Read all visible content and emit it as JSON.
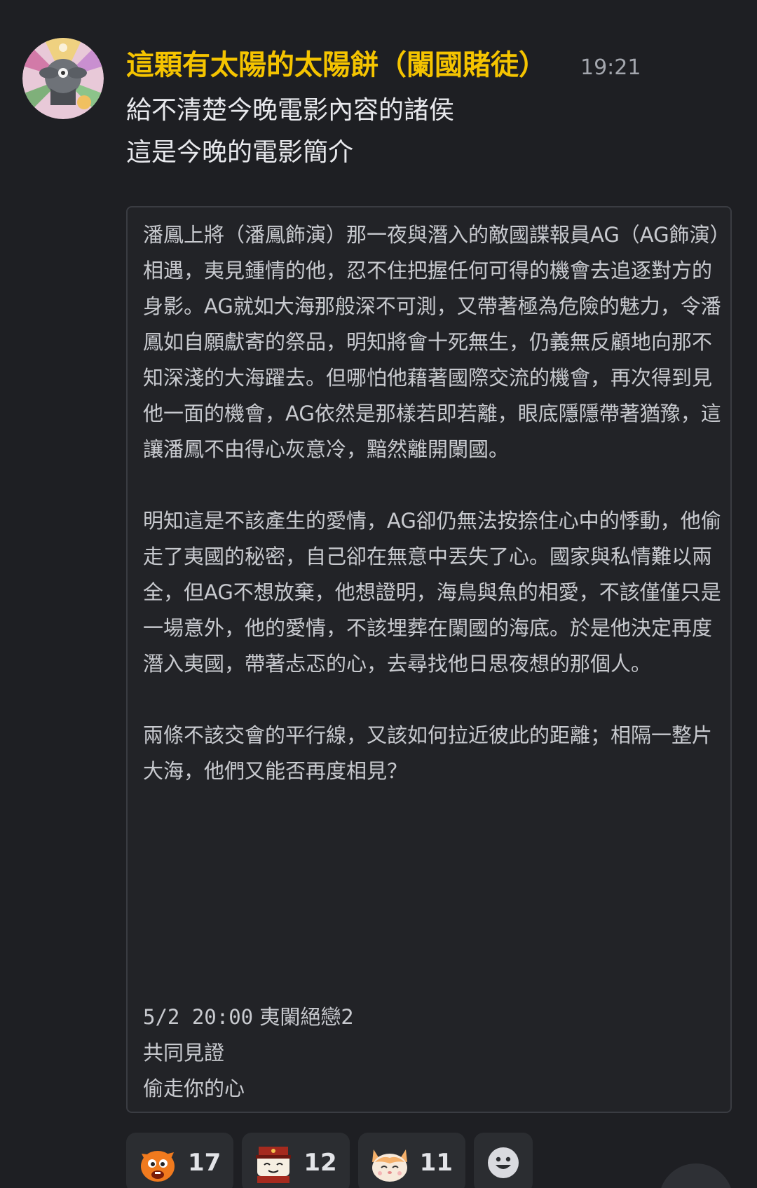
{
  "message": {
    "username": "這顆有太陽的太陽餅（闌國賭徒）",
    "timestamp": "19:21",
    "lines": [
      "給不清楚今晚電影內容的諸侯",
      "這是今晚的電影簡介"
    ],
    "codeblock": {
      "paragraphs": [
        "潘鳳上將（潘鳳飾演）那一夜與潛入的敵國諜報員AG（AG飾演）相遇，夷見鍾情的他，忍不住把握任何可得的機會去追逐對方的身影。AG就如大海那般深不可測，又帶著極為危險的魅力，令潘鳳如自願獻寄的祭品，明知將會十死無生，仍義無反顧地向那不知深淺的大海躍去。但哪怕他藉著國際交流的機會，再次得到見他一面的機會，AG依然是那樣若即若離，眼底隱隱帶著猶豫，這讓潘鳳不由得心灰意冷，黯然離開闌國。",
        "明知這是不該產生的愛情，AG卻仍無法按捺住心中的悸動，他偷走了夷國的秘密，自己卻在無意中丟失了心。國家與私情難以兩全，但AG不想放棄，他想證明，海鳥與魚的相愛，不該僅僅只是一場意外，他的愛情，不該埋葬在闌國的海底。於是他決定再度潛入夷國，帶著忐忑的心，去尋找他日思夜想的那個人。",
        "兩條不該交會的平行線，又該如何拉近彼此的距離；相隔一整片大海，他們又能否再度相見？"
      ],
      "footer": {
        "date_time": "5/2 20:00",
        "title": "夷闌絕戀2",
        "line2": "共同見證",
        "line3": "偷走你的心"
      }
    },
    "reactions": [
      {
        "emoji": "orange-cat-emoji",
        "count": "17"
      },
      {
        "emoji": "hat-character-emoji",
        "count": "12"
      },
      {
        "emoji": "cat-face-emoji",
        "count": "11"
      }
    ],
    "add_reaction_icon": "smiley-add-reaction-icon"
  },
  "colors": {
    "background": "#1e1f23",
    "username": "#f5c400",
    "codeblock_bg": "#222327",
    "reaction_bg": "#2b2d31"
  }
}
